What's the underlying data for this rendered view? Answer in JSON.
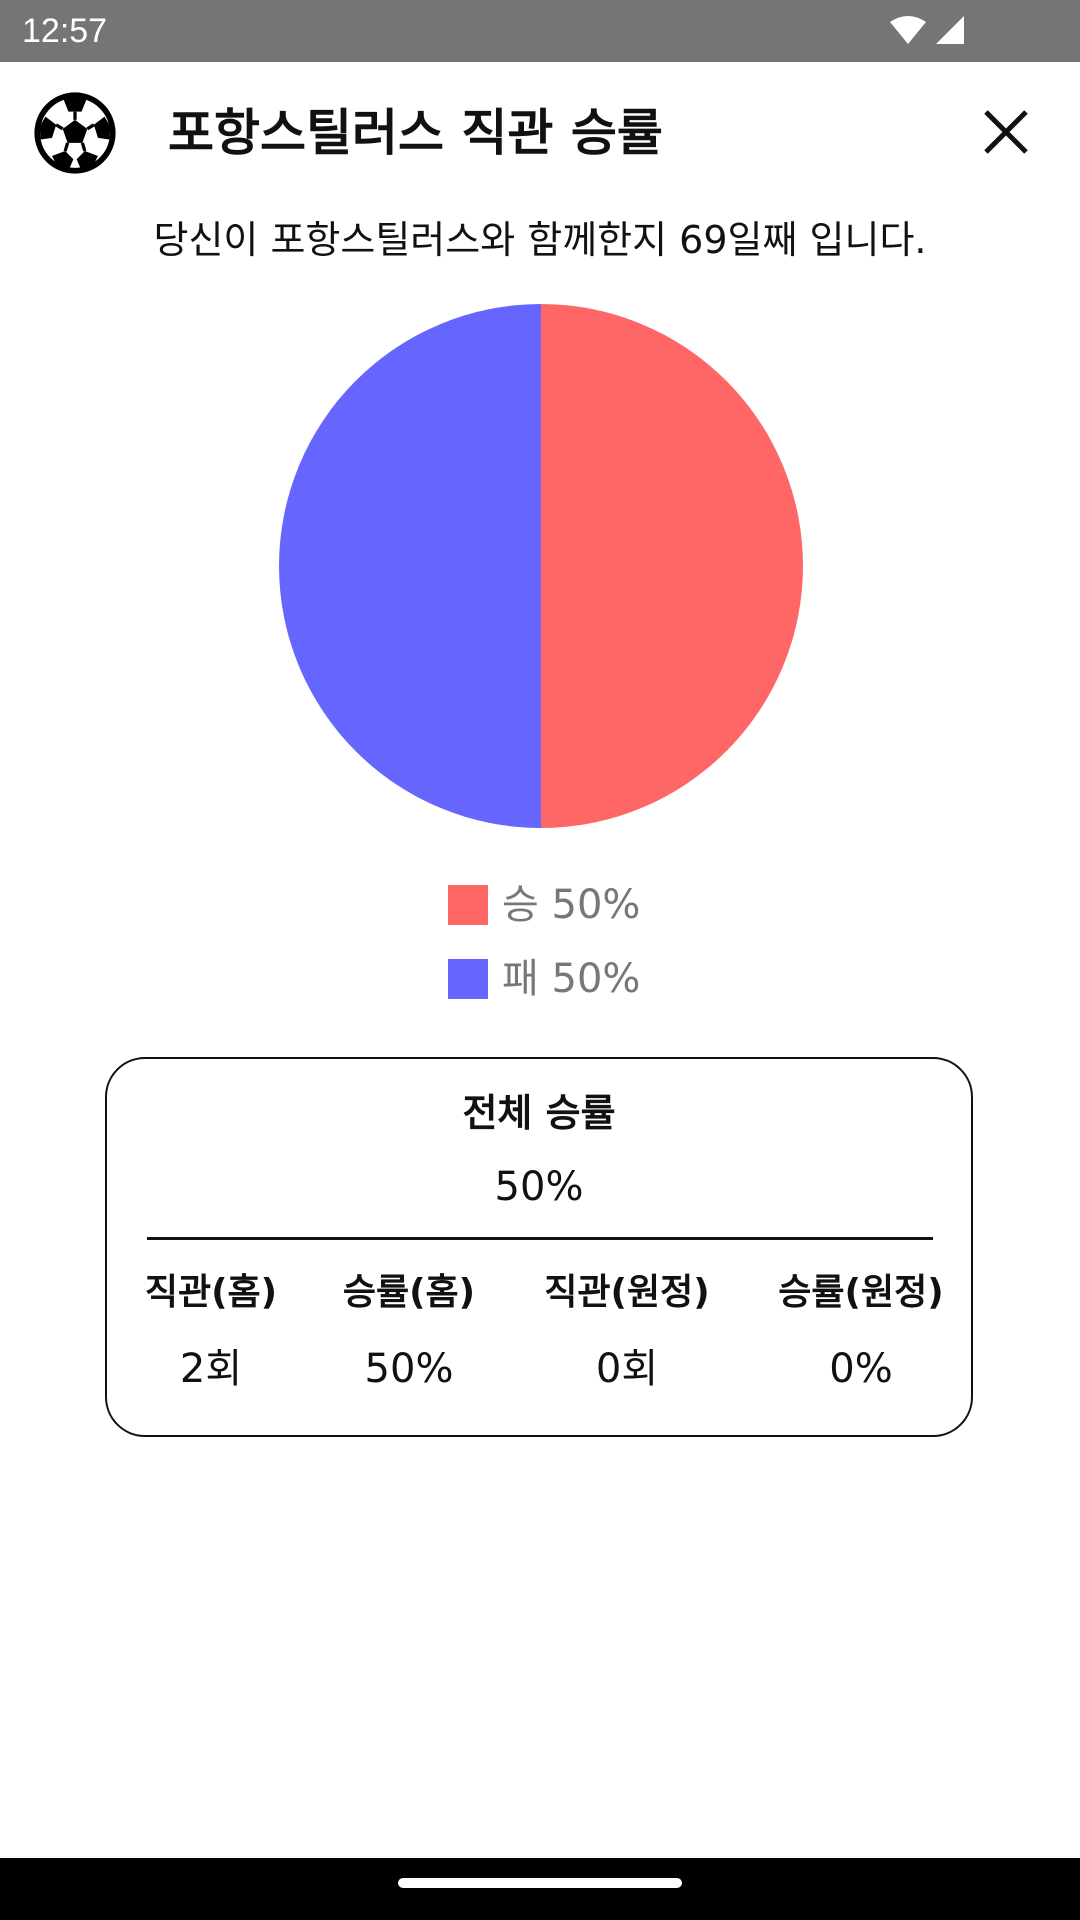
{
  "status_bar": {
    "time": "12:57",
    "icons": [
      "wifi-icon",
      "signal-icon"
    ]
  },
  "header": {
    "logo_icon": "soccer-ball-icon",
    "title": "포항스틸러스 직관 승률",
    "close_icon": "close-icon"
  },
  "subtitle": "당신이 포항스틸러스와 함께한지 69일째 입니다.",
  "chart_data": {
    "type": "pie",
    "categories": [
      "승",
      "패"
    ],
    "values": [
      50,
      50
    ],
    "colors": [
      "#ff6666",
      "#6666ff"
    ],
    "legend": [
      {
        "label": "승 50%",
        "color": "#ff6666"
      },
      {
        "label": "패 50%",
        "color": "#6666ff"
      }
    ],
    "legend_placement": "bottom"
  },
  "stats": {
    "overall_label": "전체 승률",
    "overall_value": "50%",
    "columns": [
      {
        "header": "직관(홈)",
        "value": "2회"
      },
      {
        "header": "승률(홈)",
        "value": "50%"
      },
      {
        "header": "직관(원정)",
        "value": "0회"
      },
      {
        "header": "승률(원정)",
        "value": "0%"
      }
    ]
  }
}
